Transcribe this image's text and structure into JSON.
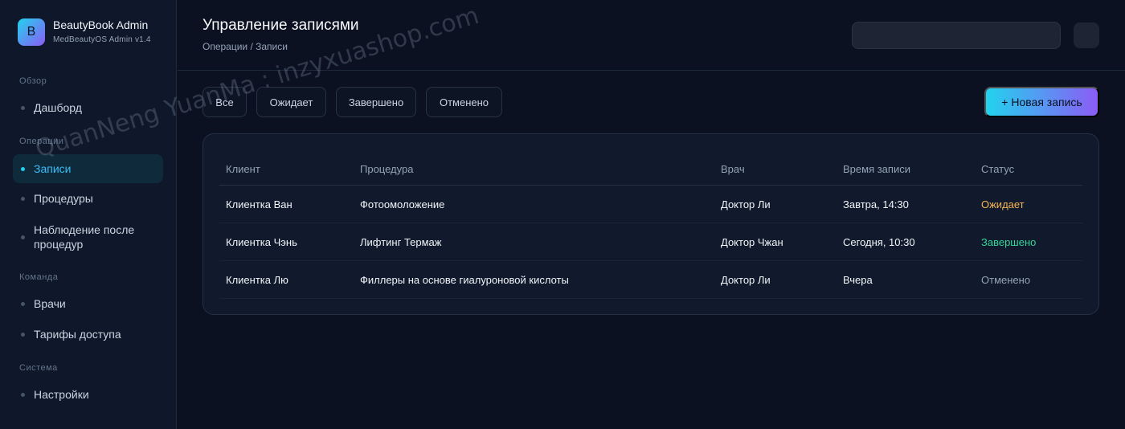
{
  "brand": {
    "logo_letter": "B",
    "title": "BeautyBook Admin",
    "subtitle": "MedBeautyOS Admin v1.4"
  },
  "sidebar": {
    "sections": [
      {
        "label": "Обзор"
      },
      {
        "label": "Операции"
      },
      {
        "label": "Команда"
      },
      {
        "label": "Система"
      }
    ],
    "items": [
      {
        "label": "Дашборд",
        "active": false
      },
      {
        "label": "Записи",
        "active": true
      },
      {
        "label": "Процедуры",
        "active": false
      },
      {
        "label": "Наблюдение после процедур",
        "active": false
      },
      {
        "label": "Врачи",
        "active": false
      },
      {
        "label": "Тарифы доступа",
        "active": false
      },
      {
        "label": "Настройки",
        "active": false
      }
    ]
  },
  "header": {
    "title": "Управление записями",
    "breadcrumb": "Операции / Записи",
    "search_value": ""
  },
  "filters": [
    "Все",
    "Ожидает",
    "Завершено",
    "Отменено"
  ],
  "new_button": "+ Новая запись",
  "table": {
    "columns": [
      "Клиент",
      "Процедура",
      "Врач",
      "Время записи",
      "Статус"
    ],
    "rows": [
      [
        "Клиентка Ван",
        "Фотоомоложение",
        "Доктор Ли",
        "Завтра, 14:30",
        "Ожидает"
      ],
      [
        "Клиентка Чэнь",
        "Лифтинг Термаж",
        "Доктор Чжан",
        "Сегодня, 10:30",
        "Завершено"
      ],
      [
        "Клиентка Лю",
        "Филлеры на основе гиалуроновой кислоты",
        "Доктор Ли",
        "Вчера",
        "Отменено"
      ]
    ]
  },
  "colors": {
    "accent": "#22d3ee",
    "accent2": "#8b5cf6",
    "status_wait": "#f5b454",
    "status_done": "#34d399",
    "status_cancel": "#94a3b8"
  },
  "watermark": "QuanNeng YuanMa : inzyxuashop.com"
}
